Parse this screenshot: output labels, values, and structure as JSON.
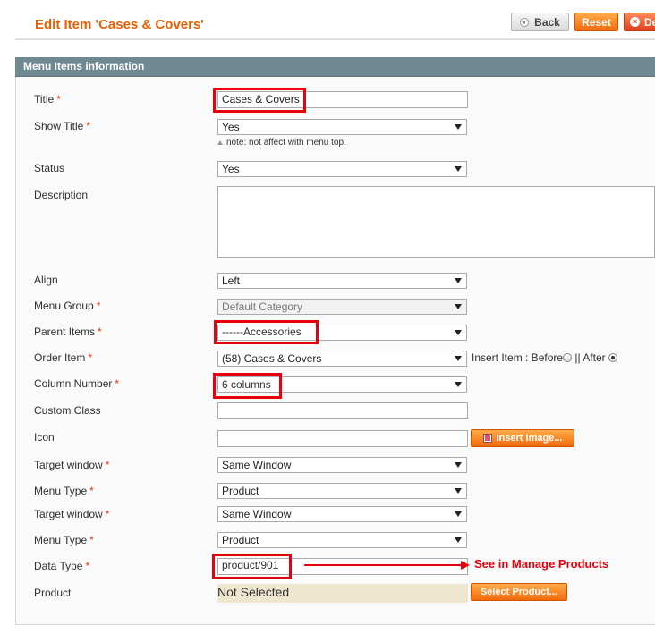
{
  "header": {
    "title": "Edit Item 'Cases & Covers'",
    "back_label": "Back",
    "reset_label": "Reset",
    "delete_label": "De"
  },
  "panel": {
    "title": "Menu Items information"
  },
  "fields": {
    "title": {
      "label": "Title",
      "value": "Cases & Covers"
    },
    "show_title": {
      "label": "Show Title",
      "value": "Yes",
      "note": "note: not affect with menu top!"
    },
    "status": {
      "label": "Status",
      "value": "Yes"
    },
    "description": {
      "label": "Description",
      "value": ""
    },
    "align": {
      "label": "Align",
      "value": "Left"
    },
    "menu_group": {
      "label": "Menu Group",
      "value": "Default Category"
    },
    "parent_items": {
      "label": "Parent Items",
      "value": "------Accessories"
    },
    "order_item": {
      "label": "Order Item",
      "value": "(58) Cases & Covers",
      "insert_label": "Insert Item : Before",
      "sep_after": "|| After",
      "selected": "After"
    },
    "column_number": {
      "label": "Column Number",
      "value": "6 columns"
    },
    "custom_class": {
      "label": "Custom Class",
      "value": ""
    },
    "icon": {
      "label": "Icon",
      "value": "",
      "button": "Insert Image..."
    },
    "target_window_1": {
      "label": "Target window",
      "value": "Same Window"
    },
    "menu_type_1": {
      "label": "Menu Type",
      "value": "Product"
    },
    "target_window_2": {
      "label": "Target window",
      "value": "Same Window"
    },
    "menu_type_2": {
      "label": "Menu Type",
      "value": "Product"
    },
    "data_type": {
      "label": "Data Type",
      "value": "product/901",
      "annotation": "See in Manage Products"
    },
    "product": {
      "label": "Product",
      "value": "Not Selected",
      "button": "Select Product..."
    }
  },
  "required_mark": "*",
  "colors": {
    "accent": "#eb5e00",
    "highlight": "#e8000b",
    "panel_header": "#6f8992"
  }
}
